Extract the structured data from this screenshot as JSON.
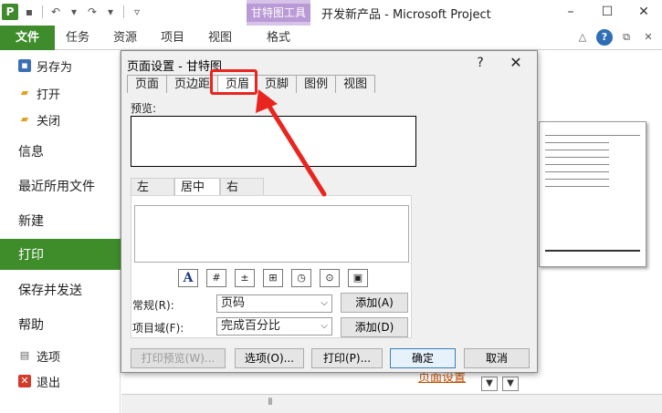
{
  "window": {
    "title": "开发新产品 - Microsoft Project",
    "context_tab_group": "甘特图工具",
    "app_icon": "P",
    "controls": [
      "–",
      "☐",
      "✕"
    ]
  },
  "ribbon": {
    "file_tab": "文件",
    "tabs": [
      "任务",
      "资源",
      "项目",
      "视图",
      "格式"
    ]
  },
  "backstage": {
    "items": [
      {
        "label": "另存为",
        "icon": "save-as-icon"
      },
      {
        "label": "打开",
        "icon": "open-folder-icon"
      },
      {
        "label": "关闭",
        "icon": "close-folder-icon"
      },
      {
        "label": "信息"
      },
      {
        "label": "最近所用文件"
      },
      {
        "label": "新建"
      },
      {
        "label": "打印",
        "active": true
      },
      {
        "label": "保存并发送"
      },
      {
        "label": "帮助"
      },
      {
        "label": "选项",
        "icon": "options-icon"
      },
      {
        "label": "退出",
        "icon": "exit-icon"
      }
    ]
  },
  "background": {
    "page_setup_link": "页面设置"
  },
  "dialog": {
    "title": "页面设置 - 甘特图",
    "help": "?",
    "close": "✕",
    "tabs": [
      "页面",
      "页边距",
      "页眉",
      "页脚",
      "图例",
      "视图"
    ],
    "active_tab": "页眉",
    "preview_label": "预览:",
    "alignment_tabs": [
      "左",
      "居中",
      "右"
    ],
    "active_alignment": "居中",
    "toolbar": {
      "font": "A",
      "page_number": "#",
      "total_pages": "±",
      "date": "⊞",
      "time": "◷",
      "file_name": "⊙",
      "picture": "▣"
    },
    "general_label": "常规(R):",
    "general_value": "页码",
    "project_field_label": "项目域(F):",
    "project_field_value": "完成百分比",
    "add_button_1": "添加(A)",
    "add_button_2": "添加(D)",
    "print_preview_button": "打印预览(W)...",
    "options_button": "选项(O)...",
    "print_button": "打印(P)...",
    "ok_button": "确定",
    "cancel_button": "取消"
  },
  "colors": {
    "accent_green": "#3f8c2b",
    "highlight_red": "#e8251f",
    "context_purple": "#b999d6"
  }
}
